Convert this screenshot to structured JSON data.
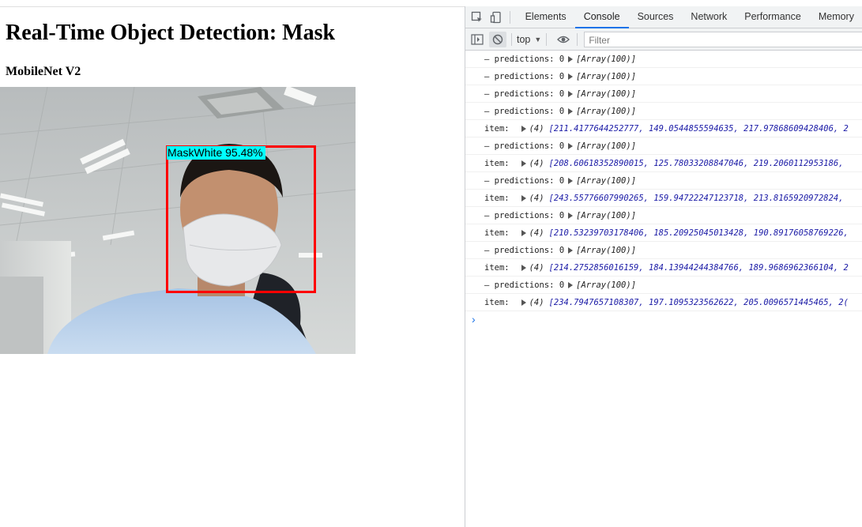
{
  "page": {
    "title": "Real-Time Object Detection: Mask",
    "subtitle": "MobileNet V2"
  },
  "detection": {
    "label": "MaskWhite 95.48%",
    "box_color": "#ff0000",
    "label_bg": "#00ffff"
  },
  "devtools": {
    "tabs": [
      "Elements",
      "Console",
      "Sources",
      "Network",
      "Performance",
      "Memory"
    ],
    "active_tab": "Console",
    "context": "top",
    "filter_placeholder": "Filter",
    "accent": "#1a73e8",
    "logs": [
      {
        "type": "pred",
        "text": "– predictions: 0",
        "arr": "[Array(100)]"
      },
      {
        "type": "pred",
        "text": "– predictions: 0",
        "arr": "[Array(100)]"
      },
      {
        "type": "pred",
        "text": "– predictions: 0",
        "arr": "[Array(100)]"
      },
      {
        "type": "pred",
        "text": "– predictions: 0",
        "arr": "[Array(100)]"
      },
      {
        "type": "item",
        "text": "item:",
        "count": "(4)",
        "values": "[211.4177644252777, 149.0544855594635, 217.97868609428406, 2"
      },
      {
        "type": "pred",
        "text": "– predictions: 0",
        "arr": "[Array(100)]"
      },
      {
        "type": "item",
        "text": "item:",
        "count": "(4)",
        "values": "[208.60618352890015, 125.78033208847046, 219.2060112953186,"
      },
      {
        "type": "pred",
        "text": "– predictions: 0",
        "arr": "[Array(100)]"
      },
      {
        "type": "item",
        "text": "item:",
        "count": "(4)",
        "values": "[243.55776607990265, 159.94722247123718, 213.8165920972824,"
      },
      {
        "type": "pred",
        "text": "– predictions: 0",
        "arr": "[Array(100)]"
      },
      {
        "type": "item",
        "text": "item:",
        "count": "(4)",
        "values": "[210.53239703178406, 185.20925045013428, 190.89176058769226,"
      },
      {
        "type": "pred",
        "text": "– predictions: 0",
        "arr": "[Array(100)]"
      },
      {
        "type": "item",
        "text": "item:",
        "count": "(4)",
        "values": "[214.2752856016159, 184.13944244384766, 189.9686962366104, 2"
      },
      {
        "type": "pred",
        "text": "– predictions: 0",
        "arr": "[Array(100)]"
      },
      {
        "type": "item",
        "text": "item:",
        "count": "(4)",
        "values": "[234.7947657108307, 197.1095323562622, 205.0096571445465, 2("
      }
    ]
  }
}
